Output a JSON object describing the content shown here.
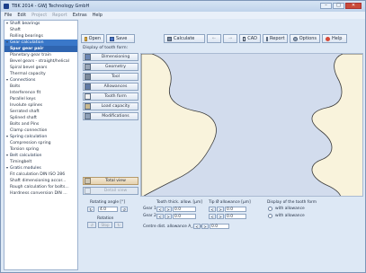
{
  "window": {
    "title": "TBK 2014 - GWJ Technology GmbH"
  },
  "menu": [
    {
      "label": "File",
      "dim": false
    },
    {
      "label": "Edit",
      "dim": false
    },
    {
      "label": "Project",
      "dim": true
    },
    {
      "label": "Report",
      "dim": true
    },
    {
      "label": "Extras",
      "dim": false
    },
    {
      "label": "Help",
      "dim": false
    }
  ],
  "sidebar": [
    {
      "label": "Shaft bearings",
      "type": "cat"
    },
    {
      "label": "Shaft",
      "type": "item"
    },
    {
      "label": "Rolling bearings",
      "type": "item"
    },
    {
      "label": "Gear calculation",
      "type": "cat",
      "state": "hl"
    },
    {
      "label": "Spur gear pair",
      "type": "item",
      "state": "sel"
    },
    {
      "label": "Planetary gear train",
      "type": "item"
    },
    {
      "label": "Bevel gears - straight/helical",
      "type": "item"
    },
    {
      "label": "Spiral bevel gears",
      "type": "item"
    },
    {
      "label": "Thermal capacity",
      "type": "item"
    },
    {
      "label": "Connections",
      "type": "cat"
    },
    {
      "label": "Bolts",
      "type": "item"
    },
    {
      "label": "Interference fit",
      "type": "item"
    },
    {
      "label": "Parallel keys",
      "type": "item"
    },
    {
      "label": "Involute splines",
      "type": "item"
    },
    {
      "label": "Serrated shaft",
      "type": "item"
    },
    {
      "label": "Splined shaft",
      "type": "item"
    },
    {
      "label": "Bolts and Pins",
      "type": "item"
    },
    {
      "label": "Clamp connection",
      "type": "item"
    },
    {
      "label": "Spring calculation",
      "type": "cat"
    },
    {
      "label": "Compression spring",
      "type": "item"
    },
    {
      "label": "Torsion spring",
      "type": "item"
    },
    {
      "label": "Belt calculation",
      "type": "cat"
    },
    {
      "label": "Timingbelt",
      "type": "item"
    },
    {
      "label": "Gratis modules",
      "type": "cat"
    },
    {
      "label": "Fit calculation DIN ISO 286",
      "type": "item"
    },
    {
      "label": "Shaft dimensioning accor...",
      "type": "item"
    },
    {
      "label": "Rough calculation for bolts...",
      "type": "item"
    },
    {
      "label": "Hardness conversion DIN ...",
      "type": "item"
    }
  ],
  "toolbar": {
    "open": "Open",
    "save": "Save",
    "calculate": "Calculate",
    "cad": "CAD",
    "report": "Report",
    "options": "Options",
    "help": "Help"
  },
  "display_label": "Display of tooth form:",
  "left_buttons": [
    "Dimensioning",
    "Geometry",
    "Tool",
    "Allowances",
    "Tooth form",
    "Load capacity",
    "Modifications"
  ],
  "view_buttons": {
    "total": "Total view",
    "detail": "Detail view"
  },
  "rotation": {
    "angle_label": "Rotating angle [°]",
    "angle_value": "4.0",
    "rotation_label": "Rotation",
    "stop": "Stop"
  },
  "tooth_thick": {
    "header": "Tooth thick. allow. [µm]",
    "gear1_label": "Gear 1",
    "gear1_value": "0.0",
    "gear2_label": "Gear 2",
    "gear2_value": "0.0",
    "centre_label": "Centre dist. allowance A_a [µm]",
    "centre_value": "0.0"
  },
  "tip": {
    "header": "Tip Ø allowance [µm]",
    "gear1_value": "0.0",
    "gear2_value": "0.0"
  },
  "display_form": {
    "header": "Display of the tooth form",
    "with_allowance": "with allowance",
    "without_allowance": "with allowance"
  },
  "colors": {
    "gear_fill": "#f9f3dc",
    "gear_stroke": "#3a3a3a",
    "canvas_bg": "#d2dced",
    "selection": "#2f65b0"
  }
}
